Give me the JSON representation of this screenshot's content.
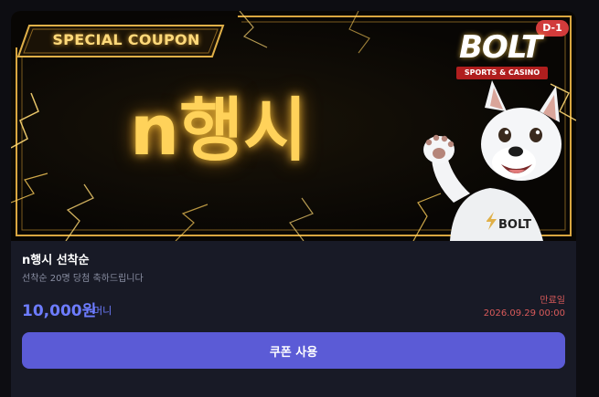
{
  "banner": {
    "tag_label": "SPECIAL COUPON",
    "headline": "n행시",
    "brand_name": "BOLT",
    "brand_tagline": "SPORTS & CASINO",
    "dday_badge": "D-1",
    "mascot_shirt_logo": "BOLT",
    "accent_color": "#ffd25a"
  },
  "coupon": {
    "title": "n행시 선착순",
    "description": "선착순 20명 당첨 축하드립니다",
    "amount": "10,000원",
    "amount_unit": "머니",
    "expiry_label": "만료일",
    "expiry_date": "2026.09.29 00:00",
    "use_button_label": "쿠폰 사용",
    "button_color": "#5b5bd6",
    "amount_color": "#6d7cff",
    "expiry_color": "#d95a5a"
  }
}
